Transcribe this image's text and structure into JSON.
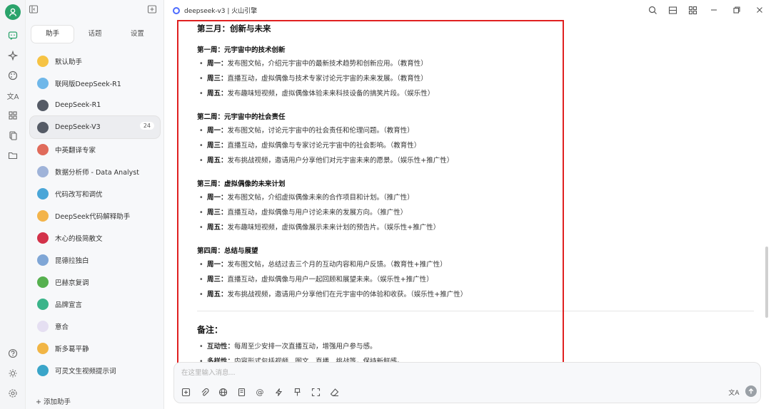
{
  "window": {
    "title": "deepseek-v3 | 火山引擎",
    "accent_color": "#2aa36b",
    "highlight_color": "#e02020"
  },
  "sidebar_tabs": [
    "助手",
    "话题",
    "设置"
  ],
  "assistants": [
    {
      "label": "默认助手",
      "color": "#f6c344",
      "icon": "star-icon"
    },
    {
      "label": "联网版DeepSeek-R1",
      "color": "#6fb7e9",
      "icon": "globe-icon"
    },
    {
      "label": "DeepSeek-R1",
      "color": "#555b66",
      "icon": "robot-icon"
    },
    {
      "label": "DeepSeek-V3",
      "color": "#555b66",
      "icon": "robot-icon",
      "badge": "24",
      "active": true
    },
    {
      "label": "中英翻译专家",
      "color": "#e06b5b",
      "icon": "books-icon"
    },
    {
      "label": "数据分析师 - Data Analyst",
      "color": "#9fb3d9",
      "icon": "chart-icon"
    },
    {
      "label": "代码改写和调优",
      "color": "#4aa6d8",
      "icon": "monitor-icon"
    },
    {
      "label": "DeepSeek代码解释助手",
      "color": "#f3b44b",
      "icon": "face-icon"
    },
    {
      "label": "木心的极简散文",
      "color": "#d3324a",
      "icon": "book-icon"
    },
    {
      "label": "昆德拉独白",
      "color": "#7fa6d6",
      "icon": "open-book-icon"
    },
    {
      "label": "巴赫京复调",
      "color": "#56b04f",
      "icon": "green-book-icon"
    },
    {
      "label": "品牌宣言",
      "color": "#3bb48a",
      "icon": "picture-icon"
    },
    {
      "label": "意合",
      "color": "#e5dff2",
      "icon": "chat-bubble-icon"
    },
    {
      "label": "斯多葛平静",
      "color": "#f1b545",
      "icon": "sun-face-icon"
    },
    {
      "label": "可灵文生视频提示词",
      "color": "#3aa5c9",
      "icon": "video-icon"
    }
  ],
  "add_assistant_label": "+ 添加助手",
  "content": {
    "month_title": "第三月：创新与未来",
    "weeks": [
      {
        "title": "第一周：元宇宙中的技术创新",
        "items": [
          {
            "day": "周一：",
            "text": "发布图文帖，介绍元宇宙中的最新技术趋势和创新应用。（教育性）"
          },
          {
            "day": "周三：",
            "text": "直播互动，虚拟偶像与技术专家讨论元宇宙的未来发展。（教育性）"
          },
          {
            "day": "周五：",
            "text": "发布趣味短视频，虚拟偶像体验未来科技设备的搞笑片段。（娱乐性）"
          }
        ]
      },
      {
        "title": "第二周：元宇宙中的社会责任",
        "items": [
          {
            "day": "周一：",
            "text": "发布图文帖，讨论元宇宙中的社会责任和伦理问题。（教育性）"
          },
          {
            "day": "周三：",
            "text": "直播互动，虚拟偶像与专家讨论元宇宙中的社会影响。（教育性）"
          },
          {
            "day": "周五：",
            "text": "发布挑战视频，邀请用户分享他们对元宇宙未来的愿景。（娱乐性+推广性）"
          }
        ]
      },
      {
        "title": "第三周：虚拟偶像的未来计划",
        "items": [
          {
            "day": "周一：",
            "text": "发布图文帖，介绍虚拟偶像未来的合作项目和计划。（推广性）"
          },
          {
            "day": "周三：",
            "text": "直播互动，虚拟偶像与用户讨论未来的发展方向。（推广性）"
          },
          {
            "day": "周五：",
            "text": "发布趣味短视频，虚拟偶像展示未来计划的预告片。（娱乐性+推广性）"
          }
        ]
      },
      {
        "title": "第四周：总结与展望",
        "items": [
          {
            "day": "周一：",
            "text": "发布图文帖，总结过去三个月的互动内容和用户反馈。（教育性+推广性）"
          },
          {
            "day": "周三：",
            "text": "直播互动，虚拟偶像与用户一起回顾和展望未来。（娱乐性+推广性）"
          },
          {
            "day": "周五：",
            "text": "发布挑战视频，邀请用户分享他们在元宇宙中的体验和收获。（娱乐性+推广性）"
          }
        ]
      }
    ],
    "notes_title": "备注：",
    "notes": [
      {
        "term": "互动性：",
        "text": "每周至少安排一次直播互动，增强用户参与感。"
      },
      {
        "term": "多样性：",
        "text": "内容形式包括视频、图文、直播、挑战等，保持新鲜感。"
      }
    ]
  },
  "input": {
    "placeholder": "在这里输入消息..."
  }
}
